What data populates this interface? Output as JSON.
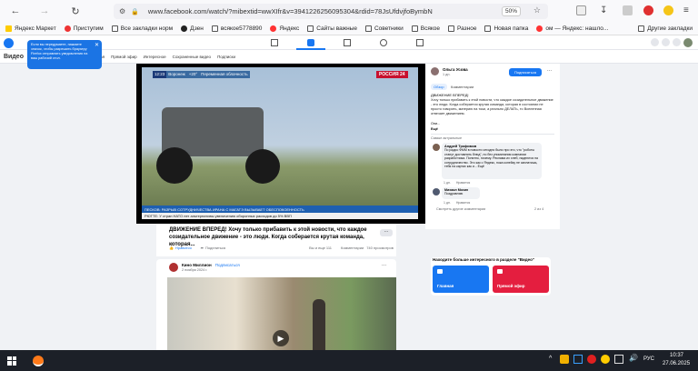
{
  "browser": {
    "url": "www.facebook.com/watch/?mibextid=wwXIfr&v=3941226256095304&rdid=78JsUfdvjfoBymbN",
    "zoom": "50%",
    "bookmarks": [
      "Яндекс Маркет",
      "Приступим",
      "Все закладки норм",
      "Дзен",
      "всякое5778890",
      "Яндекс",
      "Сайты важные",
      "Советники",
      "Всякое",
      "Разное",
      "Новая папка",
      "ом — Яндекс: нашло...",
      "Другие закладки"
    ]
  },
  "fb": {
    "section_title": "Видео",
    "tabs": [
      "Главная",
      "Прямой эфир",
      "Интересное",
      "Сохраненные видео",
      "Подписки"
    ],
    "tooltip": "Если вы передумаете, нажмите значок, чтобы разрешить браузеру Firefox отправлять уведомления на ваш рабочий стол."
  },
  "video": {
    "time": "12:23",
    "city": "Воронеж",
    "temp": "+20°",
    "region": "Переменная облачность",
    "channel": "РОССИЯ 24",
    "ticker1": "ПЕСКОВ: РАЗРЫВ СОТРУДНИЧЕСТВА ИРАНА С МАГАТЭ ВЫЗЫВАЕТ ОБЕСПОКОЕННОСТЬ",
    "ticker2": "РЮТТЕ: У стран НАТО нет альтернативы увеличению оборонных расходов до 5% ВВП"
  },
  "post1": {
    "title": "ДВИЖЕНИЕ ВПЕРЕД! Хочу только прибавить к этой новости, что каждое созидательное движение - это люди. Когда соберается крутая команда, которая...",
    "like": "Нравится",
    "share": "Поделиться",
    "stats": "Вы и еще 111",
    "comments": "Комментарии",
    "views": "740 просмотров"
  },
  "side": {
    "author": "Ольга Усова",
    "time": "1 дн.",
    "subscribe": "Подписаться",
    "tab1": "Обзор",
    "tab2": "Комментарии",
    "body_title": "ДВИЖЕНИЕ ВПЕРЕД!",
    "body": "Хочу только прибавить к этой новости, что каждое созидательное движение - это люди. Когда соберается крутая команда, которая в состоянии не просто говорить, материю на токи, а реально ДЕЛАТЬ, то Вселенная отвечает движением.",
    "body_end": "Они...",
    "more": "Ещё",
    "sort": "Самые актуальные",
    "c1_author": "Андрей Трофимов",
    "c1_text": "По радио ФММ в новости сегодня было про это, что \"роботы станут доставлять блюд\", но без упоминания компании разработчика. Понятно, почему. Реклама их хлеб, надеются на сотрудничество. Это как с Яндекс, пока копейку не заплатишь, тебя на картах как и... Ещё",
    "c1_time": "1 дн.",
    "c1_like": "Нравится",
    "c2_author": "Михаил Мохин",
    "c2_text": "Поздравляю",
    "c2_time": "1 дн.",
    "c2_like": "Нравится",
    "see_more": "Смотреть другие комментарии",
    "count": "2 из 4"
  },
  "find": {
    "title": "Находите больше интересного в разделе \"Видео\"",
    "home": "Главная",
    "live": "Прямой эфир"
  },
  "post2": {
    "author": "Кино Миллион",
    "follow": "Подписаться",
    "date": "2 ноября 2024 г."
  },
  "taskbar": {
    "lang": "РУС",
    "time": "10:37",
    "date": "27.06.2025"
  }
}
